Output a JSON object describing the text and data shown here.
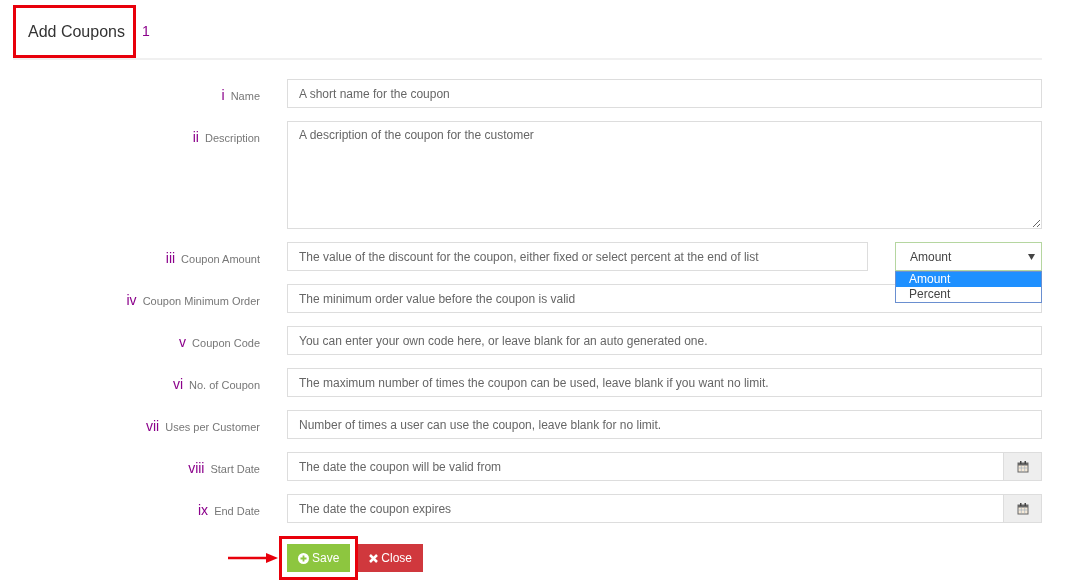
{
  "header": {
    "title": "Add Coupons",
    "highlighted": true,
    "step": "1"
  },
  "fields": [
    {
      "kind": "text",
      "marker": "i",
      "label": "Name",
      "placeholder": "A short name for the coupon"
    },
    {
      "kind": "textarea",
      "marker": "ii",
      "label": "Description",
      "placeholder": "A description of the coupon for the customer"
    },
    {
      "kind": "text_select",
      "marker": "iii",
      "label": "Coupon Amount",
      "placeholder": "The value of the discount for the coupon, either fixed or select percent at the end of list",
      "select": {
        "value": "Amount",
        "expanded": true,
        "options": [
          {
            "label": "Amount",
            "selected": true
          },
          {
            "label": "Percent",
            "selected": false
          }
        ]
      }
    },
    {
      "kind": "text",
      "marker": "iv",
      "label": "Coupon Minimum Order",
      "placeholder": "The minimum order value before the coupon is valid"
    },
    {
      "kind": "text",
      "marker": "v",
      "label": "Coupon Code",
      "placeholder": "You can enter your own code here, or leave blank for an auto generated one."
    },
    {
      "kind": "text",
      "marker": "vi",
      "label": "No. of Coupon",
      "placeholder": "The maximum number of times the coupon can be used, leave blank if you want no limit."
    },
    {
      "kind": "text",
      "marker": "vii",
      "label": "Uses per Customer",
      "placeholder": "Number of times a user can use the coupon, leave blank for no limit."
    },
    {
      "kind": "date",
      "marker": "viii",
      "label": "Start Date",
      "placeholder": "The date the coupon will be valid from"
    },
    {
      "kind": "date",
      "marker": "ix",
      "label": "End Date",
      "placeholder": "The date the coupon expires"
    }
  ],
  "buttons": [
    {
      "kind": "save",
      "label": "Save",
      "highlighted": true
    },
    {
      "kind": "close",
      "label": "Close",
      "highlighted": false
    }
  ]
}
